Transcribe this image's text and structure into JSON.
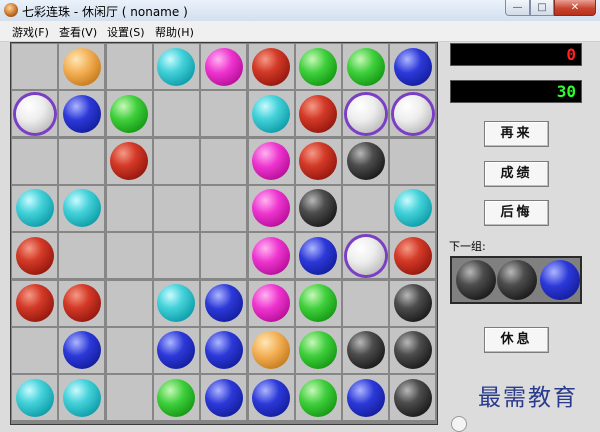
{
  "window": {
    "title": "七彩连珠 - 休闲厅 ( noname )"
  },
  "menu": [
    {
      "label": "游戏(F)"
    },
    {
      "label": "查看(V)"
    },
    {
      "label": "设置(S)"
    },
    {
      "label": "帮助(H)"
    }
  ],
  "game": {
    "score": "0",
    "target": "30",
    "buttons": {
      "restart": "再来",
      "scores": "成绩",
      "undo": "后悔",
      "rest": "休息"
    },
    "next_label": "下一组:",
    "next_balls": [
      "black",
      "black",
      "blue"
    ],
    "board": [
      [
        "",
        "orange",
        "",
        "cyan",
        "magenta",
        "red",
        "green",
        "green",
        "blue"
      ],
      [
        "white",
        "blue",
        "green",
        "",
        "",
        "cyan",
        "red",
        "white",
        "white"
      ],
      [
        "",
        "",
        "red",
        "",
        "",
        "magenta",
        "red",
        "black",
        ""
      ],
      [
        "cyan",
        "cyan",
        "",
        "",
        "",
        "magenta",
        "black",
        "",
        "cyan"
      ],
      [
        "red",
        "",
        "",
        "",
        "",
        "magenta",
        "blue",
        "white",
        "red"
      ],
      [
        "red",
        "red",
        "",
        "cyan",
        "blue",
        "magenta",
        "green",
        "",
        "black"
      ],
      [
        "",
        "blue",
        "",
        "blue",
        "blue",
        "orange",
        "green",
        "black",
        "black"
      ],
      [
        "cyan",
        "cyan",
        "",
        "green",
        "blue",
        "blue",
        "green",
        "blue",
        "black"
      ]
    ],
    "selected_color": "#7a3fc4"
  },
  "watermark": "最需教育"
}
